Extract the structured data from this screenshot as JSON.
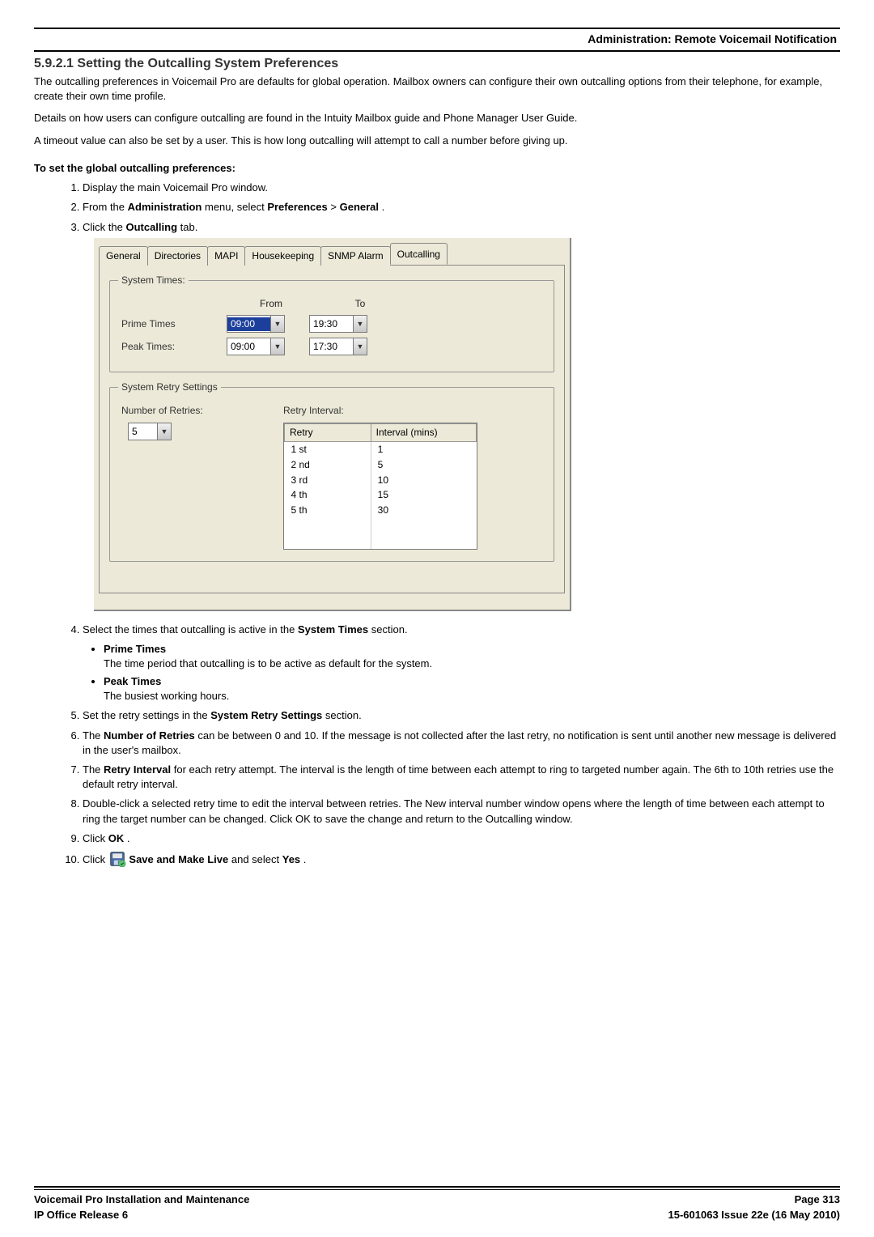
{
  "header": {
    "title": "Administration: Remote Voicemail Notification"
  },
  "section": {
    "number": "5.9.2.1",
    "title": "Setting the Outcalling System Preferences"
  },
  "paragraphs": {
    "p1": "The outcalling preferences in Voicemail Pro are defaults for global operation. Mailbox owners can configure their own outcalling options from their telephone, for example, create their own time profile.",
    "p2": "Details on how users can configure outcalling are found in the Intuity Mailbox guide and Phone Manager User Guide.",
    "p3": "A timeout value can also be set by a user. This is how long outcalling will attempt to call a number before giving up."
  },
  "subheading": "To set the global outcalling preferences:",
  "steps": {
    "s1": "Display the main Voicemail Pro window.",
    "s2a": "From the ",
    "s2b": "Administration",
    "s2c": " menu, select ",
    "s2d": "Preferences",
    "s2e": " > ",
    "s2f": "General",
    "s2g": ".",
    "s3a": "Click the ",
    "s3b": "Outcalling",
    "s3c": " tab.",
    "s4a": "Select the times that outcalling is active in the ",
    "s4b": "System Times",
    "s4c": " section.",
    "prime_label": "Prime Times",
    "prime_desc": "The time period that outcalling is to be active as default for the system.",
    "peak_label": "Peak Times",
    "peak_desc": "The busiest working hours.",
    "s5a": "Set the retry settings in the ",
    "s5b": "System Retry Settings",
    "s5c": " section.",
    "s6a": "The ",
    "s6b": "Number of Retries",
    "s6c": " can be between 0 and 10. If the message is not collected after the last retry, no notification is sent until another new message is delivered in the user's mailbox.",
    "s7a": "The ",
    "s7b": "Retry Interval",
    "s7c": " for each retry attempt. The interval is the length of time between each attempt to ring to targeted number again. The 6th to 10th retries use the default retry interval.",
    "s8a": "Double-click a selected retry time to edit the interval between retries. The New interval number window opens where the length of time between each attempt to ring the target number can be changed. Click OK to save the change and return to the Outcalling window.",
    "s9a": "Click ",
    "s9b": "OK",
    "s9c": ".",
    "s10a": "Click ",
    "s10b": " Save and Make Live",
    "s10c": " and select ",
    "s10d": "Yes",
    "s10e": "."
  },
  "dialog": {
    "tabs": {
      "general": "General",
      "directories": "Directories",
      "mapi": "MAPI",
      "housekeeping": "Housekeeping",
      "snmp": "SNMP Alarm",
      "outcalling": "Outcalling"
    },
    "systemTimes": {
      "legend": "System Times:",
      "fromLabel": "From",
      "toLabel": "To",
      "primeLabel": "Prime Times",
      "primeFrom": "09:00",
      "primeTo": "19:30",
      "peakLabel": "Peak Times:",
      "peakFrom": "09:00",
      "peakTo": "17:30"
    },
    "retry": {
      "legend": "System Retry Settings",
      "numLabel": "Number of Retries:",
      "numValue": "5",
      "intervalLabel": "Retry Interval:",
      "colRetry": "Retry",
      "colInterval": "Interval (mins)",
      "rows": [
        {
          "r": "1 st",
          "i": "1"
        },
        {
          "r": "2 nd",
          "i": "5"
        },
        {
          "r": "3 rd",
          "i": "10"
        },
        {
          "r": "4 th",
          "i": "15"
        },
        {
          "r": "5 th",
          "i": "30"
        }
      ]
    }
  },
  "footer": {
    "left1": "Voicemail Pro Installation and Maintenance",
    "left2": "IP Office Release 6",
    "right1": "Page 313",
    "right2": "15-601063 Issue 22e (16 May 2010)"
  }
}
